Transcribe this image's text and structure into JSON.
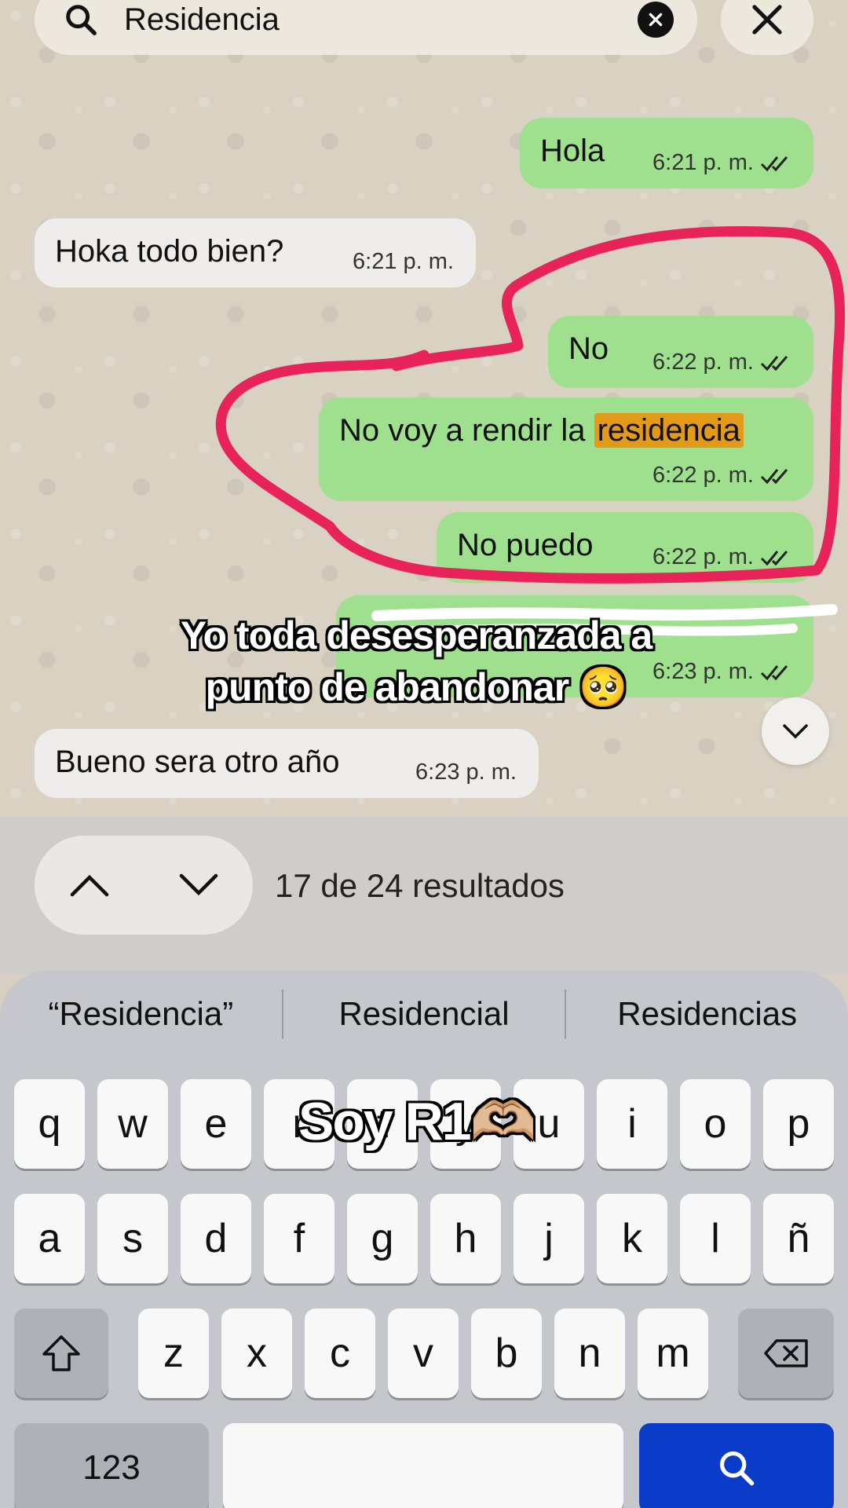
{
  "search": {
    "query": "Residencia"
  },
  "messages": [
    {
      "text": "Hola",
      "time": "6:21 p. m.",
      "direction": "out"
    },
    {
      "text": "Hoka todo bien?",
      "time": "6:21 p. m.",
      "direction": "in"
    },
    {
      "text": "No",
      "time": "6:22 p. m.",
      "direction": "out"
    },
    {
      "text_before": "No voy a rendir la ",
      "text_match": "residencia",
      "time": "6:22 p. m.",
      "direction": "out"
    },
    {
      "text": "No puedo",
      "time": "6:22 p. m.",
      "direction": "out"
    },
    {
      "text": "",
      "time": "6:23 p. m.",
      "direction": "out"
    },
    {
      "text": "Bueno sera otro año",
      "time": "6:23 p. m.",
      "direction": "in"
    }
  ],
  "caption_top": {
    "line1": "Yo toda desesperanzada a",
    "line2": "punto de abandonar 🥺"
  },
  "caption_keyboard": "Soy R1🫶🏼",
  "results": {
    "label": "17 de 24 resultados"
  },
  "suggestions": [
    "“Residencia”",
    "Residencial",
    "Residencias"
  ],
  "keys": {
    "row1": [
      "q",
      "w",
      "e",
      "r",
      "t",
      "y",
      "u",
      "i",
      "o",
      "p"
    ],
    "row2": [
      "a",
      "s",
      "d",
      "f",
      "g",
      "h",
      "j",
      "k",
      "l",
      "ñ"
    ],
    "row3": [
      "z",
      "x",
      "c",
      "v",
      "b",
      "n",
      "m"
    ],
    "numbers_label": "123"
  },
  "colors": {
    "outgoing_bubble": "#9fe08e",
    "highlight": "#e29a18",
    "annotation": "#e8235a",
    "search_key": "#0a3cc9"
  }
}
